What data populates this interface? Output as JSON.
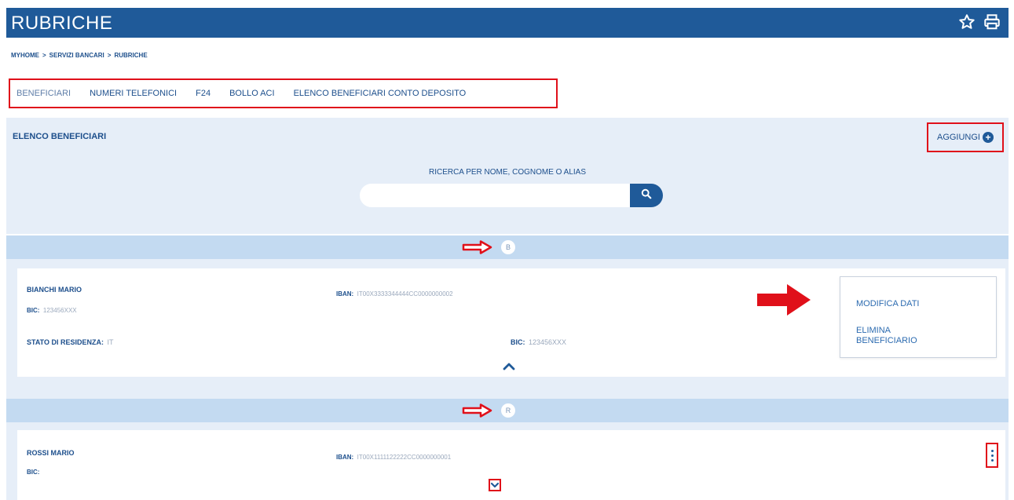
{
  "header": {
    "title": "RUBRICHE",
    "icons": [
      "star-icon",
      "print-icon"
    ]
  },
  "breadcrumb": [
    "MYHOME",
    "SERVIZI BANCARI",
    "RUBRICHE"
  ],
  "breadcrumb_sep": ">",
  "tabs": [
    {
      "label": "BENEFICIARI"
    },
    {
      "label": "NUMERI TELEFONICI"
    },
    {
      "label": "F24"
    },
    {
      "label": "BOLLO ACI"
    },
    {
      "label": "ELENCO BENEFICIARI CONTO DEPOSITO"
    }
  ],
  "section": {
    "title": "ELENCO BENEFICIARI",
    "add_label": "AGGIUNGI",
    "search_label": "RICERCA PER NOME, COGNOME O ALIAS",
    "search_value": "",
    "search_placeholder": ""
  },
  "groups": [
    {
      "letter": "B",
      "entries": [
        {
          "name": "BIANCHI MARIO",
          "bic_label": "BIC:",
          "bic": "123456XXX",
          "iban_label": "IBAN:",
          "iban": "IT00X3333344444CC0000000002",
          "residence_label": "STATO DI RESIDENZA:",
          "residence": "IT",
          "bic2_label": "BIC:",
          "bic2": "123456XXX",
          "menu": {
            "edit": "MODIFICA DATI",
            "delete": "ELIMINA BENEFICIARIO"
          }
        }
      ]
    },
    {
      "letter": "R",
      "entries": [
        {
          "name": "ROSSI MARIO",
          "bic_label": "BIC:",
          "bic": "",
          "iban_label": "IBAN:",
          "iban": "IT00X1111122222CC0000000001"
        }
      ]
    }
  ],
  "colors": {
    "header_bg": "#1f5a99",
    "panel_bg": "#e6eef8",
    "band_bg": "#c3daf1",
    "highlight": "#e0101a",
    "text": "#1d4f8c"
  }
}
